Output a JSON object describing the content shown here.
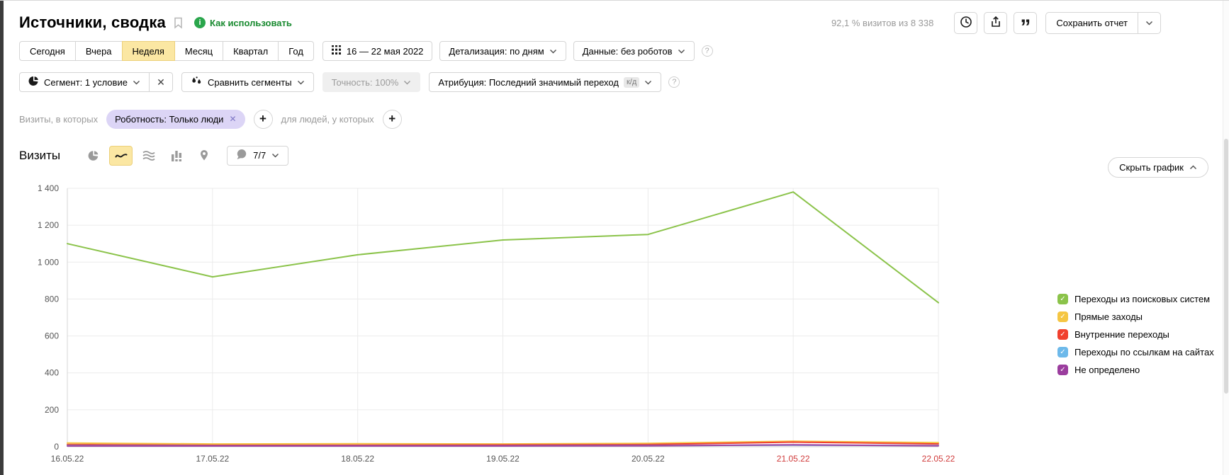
{
  "header": {
    "title": "Источники, сводка",
    "how_to_use": "Как использовать",
    "visits_share": "92,1 % визитов из 8 338",
    "save_report": "Сохранить отчет"
  },
  "period_row": {
    "tabs": [
      "Сегодня",
      "Вчера",
      "Неделя",
      "Месяц",
      "Квартал",
      "Год"
    ],
    "selected_tab": "Неделя",
    "date_range": "16 — 22 мая 2022",
    "detalization": "Детализация: по дням",
    "data_mode": "Данные: без роботов"
  },
  "segment_row": {
    "segment": "Сегмент: 1 условие",
    "compare": "Сравнить сегменты",
    "accuracy": "Точность: 100%",
    "attribution": "Атрибуция: Последний значимый переход",
    "attribution_badge": "к/д"
  },
  "filter_row": {
    "visits_prefix": "Визиты, в которых",
    "robot_filter": "Роботность: Только люди",
    "people_prefix": "для людей, у которых"
  },
  "visits_toolbar": {
    "title": "Визиты",
    "chart_types": [
      "pie",
      "line",
      "area",
      "columns",
      "map"
    ],
    "selected_chart_type": "line",
    "series_counter": "7/7",
    "hide_chart_label": "Скрыть график"
  },
  "icons": {
    "info_glyph": "i",
    "help_glyph": "?",
    "close_glyph": "✕",
    "plus_glyph": "+",
    "quotes_glyph": "”",
    "check_glyph": "✓"
  },
  "colors": {
    "selected_tab_bg": "#fbe7a3",
    "link_green": "#188a2f",
    "filter_pill_bg": "#dcd5f6",
    "weekend_red": "#d03b3b"
  },
  "chart_data": {
    "type": "line",
    "title": "Визиты",
    "x": [
      "16.05.22",
      "17.05.22",
      "18.05.22",
      "19.05.22",
      "20.05.22",
      "21.05.22",
      "22.05.22"
    ],
    "weekend_labels": [
      "21.05.22",
      "22.05.22"
    ],
    "ylim": [
      0,
      1400
    ],
    "ytick_step": 200,
    "grid": true,
    "legend_position": "right",
    "weekend_color": "#d03b3b",
    "series": [
      {
        "name": "Переходы из поисковых систем",
        "color": "#8bc34a",
        "values": [
          1100,
          920,
          1040,
          1120,
          1150,
          1380,
          780
        ]
      },
      {
        "name": "Прямые заходы",
        "color": "#f5c643",
        "values": [
          20,
          15,
          16,
          15,
          18,
          30,
          22
        ]
      },
      {
        "name": "Внутренние переходы",
        "color": "#f1402e",
        "values": [
          12,
          8,
          9,
          10,
          12,
          25,
          15
        ]
      },
      {
        "name": "Переходы по ссылкам на сайтах",
        "color": "#6db9ea",
        "values": [
          6,
          5,
          5,
          5,
          6,
          8,
          6
        ]
      },
      {
        "name": "Не определено",
        "color": "#9b3d9e",
        "values": [
          4,
          4,
          4,
          4,
          5,
          10,
          5
        ]
      }
    ]
  }
}
